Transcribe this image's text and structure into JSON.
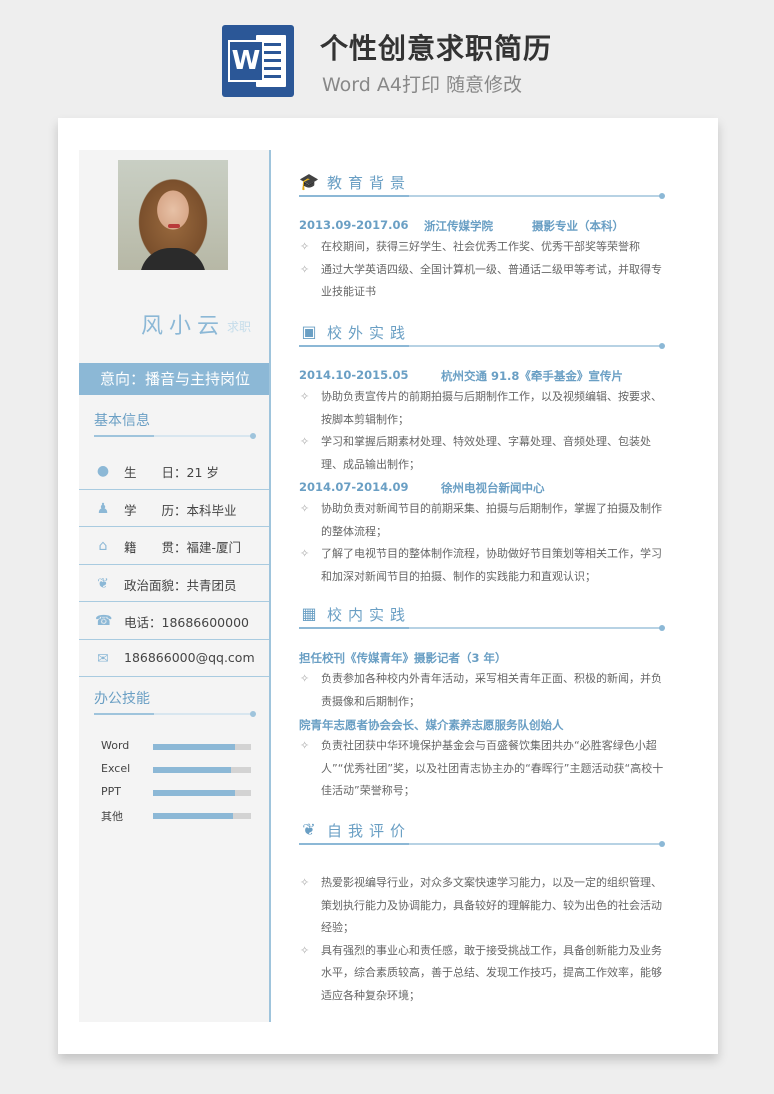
{
  "header": {
    "title": "个性创意求职简历",
    "subtitle": "Word A4打印 随意修改",
    "logo_letter": "W"
  },
  "profile": {
    "name": "风小云",
    "name_suffix": "求职",
    "intent": "意向：播音与主持岗位"
  },
  "sidebar": {
    "basic_title": "基本信息",
    "info": [
      {
        "icon": "clock-icon",
        "text": "生　　日：21 岁"
      },
      {
        "icon": "user-icon",
        "text": "学　　历：本科毕业"
      },
      {
        "icon": "home-icon",
        "text": "籍　　贯：福建-厦门"
      },
      {
        "icon": "leaf-icon",
        "text": "政治面貌：共青团员"
      },
      {
        "icon": "phone-icon",
        "text": "电话：18686600000"
      },
      {
        "icon": "mail-icon",
        "text": "186866000@qq.com"
      }
    ],
    "skills_title": "办公技能",
    "skills": [
      {
        "label": "Word",
        "level": 0.84
      },
      {
        "label": "Excel",
        "level": 0.8
      },
      {
        "label": "PPT",
        "level": 0.84
      },
      {
        "label": "其他",
        "level": 0.82
      }
    ]
  },
  "sections": {
    "education": {
      "title": "教育背景",
      "entry": {
        "date": "2013.09-2017.06",
        "org": "浙江传媒学院",
        "role": "摄影专业（本科）"
      },
      "bullets": [
        "在校期间，获得三好学生、社会优秀工作奖、优秀干部奖等荣誉称",
        "通过大学英语四级、全国计算机一级、普通话二级甲等考试，并取得专业技能证书"
      ]
    },
    "external": {
      "title": "校外实践",
      "entries": [
        {
          "date": "2014.10-2015.05",
          "org": "杭州交通 91.8《牵手基金》宣传片",
          "bullets": [
            "协助负责宣传片的前期拍摄与后期制作工作，以及视频编辑、按要求、按脚本剪辑制作；",
            "学习和掌握后期素材处理、特效处理、字幕处理、音频处理、包装处理、成品输出制作；"
          ]
        },
        {
          "date": "2014.07-2014.09",
          "org": "徐州电视台新闻中心",
          "bullets": [
            "协助负责对新闻节目的前期采集、拍摄与后期制作，掌握了拍摄及制作的整体流程；",
            "了解了电视节目的整体制作流程，协助做好节目策划等相关工作，学习和加深对新闻节目的拍摄、制作的实践能力和直观认识；"
          ]
        }
      ]
    },
    "internal": {
      "title": "校内实践",
      "entries": [
        {
          "heading": "担任校刊《传媒青年》摄影记者（3 年）",
          "bullets": [
            "负责参加各种校内外青年活动，采写相关青年正面、积极的新闻，并负责摄像和后期制作；"
          ]
        },
        {
          "heading": "院青年志愿者协会会长、媒介素养志愿服务队创始人",
          "bullets": [
            "负责社团获中华环境保护基金会与百盛餐饮集团共办“必胜客绿色小超人”“优秀社团”奖，以及社团青志协主办的“春晖行”主题活动获“高校十佳活动”荣誉称号；"
          ]
        }
      ]
    },
    "self": {
      "title": "自我评价",
      "bullets": [
        "热爱影视编导行业，对众多文案快速学习能力，以及一定的组织管理、策划执行能力及协调能力，具备较好的理解能力、较为出色的社会活动经验；",
        "具有强烈的事业心和责任感，敢于接受挑战工作，具备创新能力及业务水平，综合素质较高，善于总结、发现工作技巧，提高工作效率，能够适应各种复杂环境；"
      ]
    }
  },
  "colors": {
    "accent": "#8cb8d6",
    "accent_dark": "#6a9fc4",
    "sidebar_bg": "#f4f4f4",
    "word_blue": "#2b5797"
  }
}
